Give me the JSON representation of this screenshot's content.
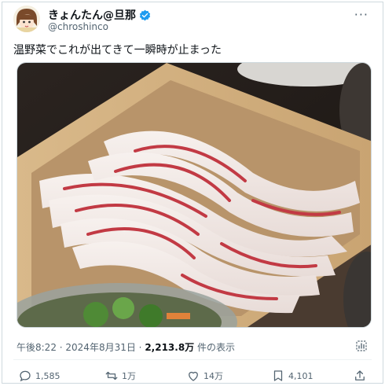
{
  "author": {
    "display_name": "きょんたん@旦那",
    "handle": "@chroshinco",
    "verified": true
  },
  "tweet": {
    "text": "温野菜でこれが出てきて一瞬時が止まった"
  },
  "meta": {
    "time": "午後8:22",
    "separator": " · ",
    "date": "2024年8月31日",
    "separator2": " · ",
    "views": "2,213.8万",
    "views_suffix": " 件の表示"
  },
  "actions": {
    "replies": "1,585",
    "reposts": "1万",
    "likes": "14万",
    "bookmarks": "4,101"
  },
  "colors": {
    "verified": "#1d9bf0",
    "text_secondary": "#536471"
  },
  "icons": [
    "more-icon",
    "reply-icon",
    "repost-icon",
    "like-icon",
    "bookmark-icon",
    "share-icon",
    "analytics-icon",
    "verified-icon"
  ]
}
